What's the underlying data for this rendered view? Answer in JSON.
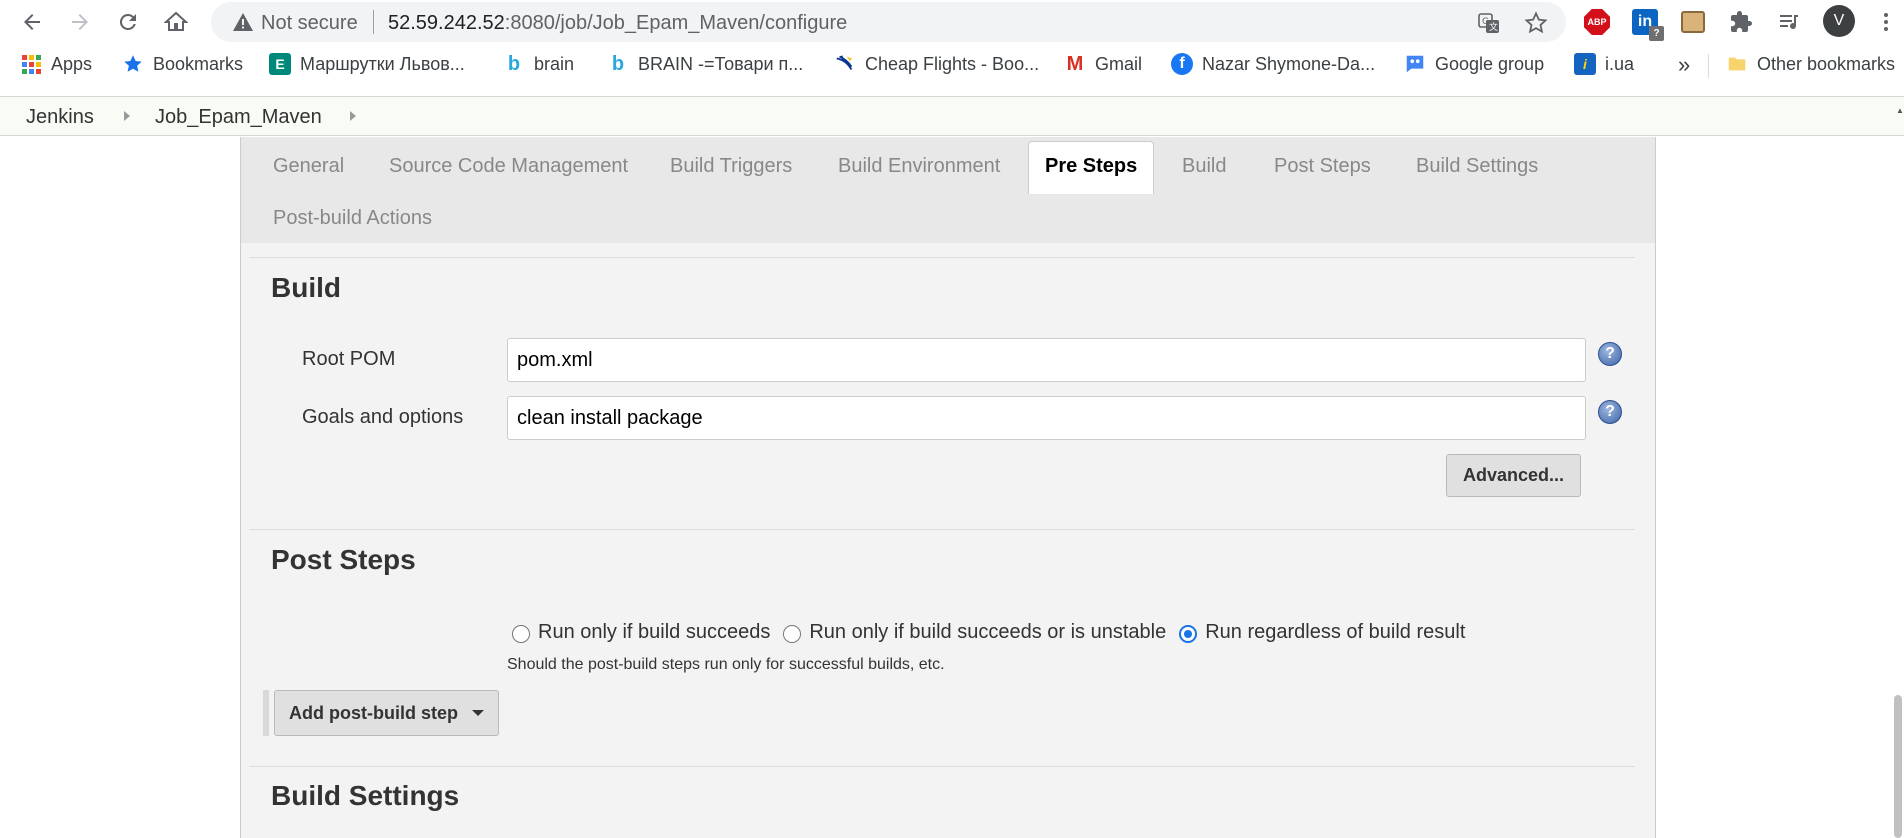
{
  "browser": {
    "security_label": "Not secure",
    "url_host": "52.59.242.52",
    "url_rest": ":8080/job/Job_Epam_Maven/configure",
    "avatar_initial": "V",
    "abp_label": "ABP",
    "linkedin_label": "in",
    "linkedin_badge": "?",
    "icons": [
      "back-icon",
      "forward-icon",
      "reload-icon",
      "home-icon",
      "warning-icon",
      "translate-icon",
      "star-icon",
      "adblock-icon",
      "linkedin-icon",
      "box-extension-icon",
      "puzzle-icon",
      "media-icon",
      "menu-icon"
    ]
  },
  "bookmarks": {
    "items": [
      {
        "label": "Apps",
        "icon": "apps-grid-icon"
      },
      {
        "label": "Bookmarks",
        "icon": "star-icon",
        "color": "#1a73e8"
      },
      {
        "label": "Маршрутки Львов...",
        "icon": "e-icon",
        "icon_text": "E",
        "color": "#00897b"
      },
      {
        "label": "brain",
        "icon": "b-icon",
        "icon_text": "b",
        "color": "#29a8e0"
      },
      {
        "label": "BRAIN -=Товари п...",
        "icon": "b-icon",
        "icon_text": "b",
        "color": "#29a8e0"
      },
      {
        "label": "Cheap Flights - Boo...",
        "icon": "ryanair-icon",
        "color": "#073590"
      },
      {
        "label": "Gmail",
        "icon": "gmail-icon",
        "icon_text": "M",
        "color": "#d93025"
      },
      {
        "label": "Nazar Shymone-Da...",
        "icon": "facebook-icon",
        "icon_text": "f",
        "color": "#1877f2"
      },
      {
        "label": "Google group",
        "icon": "google-groups-icon",
        "color": "#4285f4"
      },
      {
        "label": "i.ua",
        "icon": "iua-icon",
        "icon_text": "i",
        "color": "#1565c0"
      }
    ],
    "more_label": "»",
    "other_label": "Other bookmarks"
  },
  "breadcrumb": {
    "items": [
      "Jenkins",
      "Job_Epam_Maven"
    ]
  },
  "tabs": [
    {
      "label": "General",
      "active": false
    },
    {
      "label": "Source Code Management",
      "active": false
    },
    {
      "label": "Build Triggers",
      "active": false
    },
    {
      "label": "Build Environment",
      "active": false
    },
    {
      "label": "Pre Steps",
      "active": true
    },
    {
      "label": "Build",
      "active": false
    },
    {
      "label": "Post Steps",
      "active": false
    },
    {
      "label": "Build Settings",
      "active": false
    },
    {
      "label": "Post-build Actions",
      "active": false
    }
  ],
  "build": {
    "title": "Build",
    "root_pom_label": "Root POM",
    "root_pom_value": "pom.xml",
    "goals_label": "Goals and options",
    "goals_value": "clean install package",
    "help_glyph": "?",
    "advanced_label": "Advanced..."
  },
  "post_steps": {
    "title": "Post Steps",
    "options": [
      {
        "label": "Run only if build succeeds",
        "checked": false
      },
      {
        "label": "Run only if build succeeds or is unstable",
        "checked": false
      },
      {
        "label": "Run regardless of build result",
        "checked": true
      }
    ],
    "hint": "Should the post-build steps run only for successful builds, etc.",
    "add_step_label": "Add post-build step"
  },
  "build_settings": {
    "title": "Build Settings"
  },
  "colors": {
    "accent": "#1a73e8",
    "panel_bg": "#f3f3f3",
    "tabbar_bg": "#e8e8e8",
    "breadcrumb_bg": "#f9fcf5"
  }
}
